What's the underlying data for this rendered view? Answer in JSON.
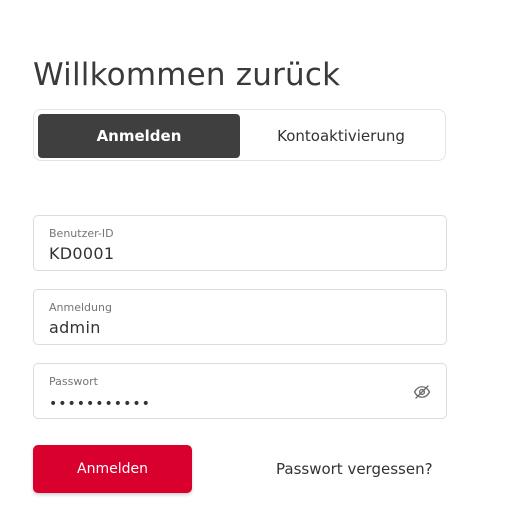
{
  "page": {
    "title": "Willkommen zurück"
  },
  "tabs": [
    {
      "label": "Anmelden",
      "active": true
    },
    {
      "label": "Kontoaktivierung",
      "active": false
    }
  ],
  "form": {
    "user_id": {
      "label": "Benutzer-ID",
      "value": "KD0001"
    },
    "login": {
      "label": "Anmeldung",
      "value": "admin"
    },
    "password": {
      "label": "Passwort",
      "value": "•••••••••••",
      "toggle_icon": "eye-off-icon"
    }
  },
  "actions": {
    "submit_label": "Anmelden",
    "forgot_password_label": "Passwort vergessen?"
  },
  "colors": {
    "primary": "#d9002d",
    "tab_active_bg": "#3f3f3f"
  }
}
